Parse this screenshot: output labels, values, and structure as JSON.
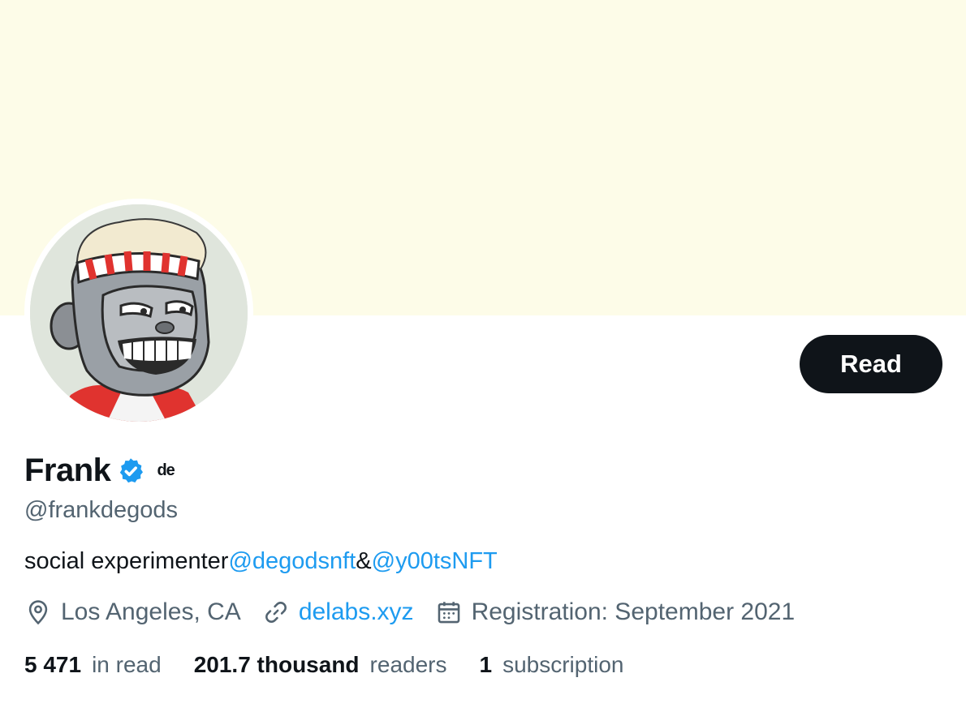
{
  "banner": {
    "color": "#fdfce8"
  },
  "profile": {
    "display_name": "Frank",
    "affiliate_label": "de",
    "handle": "@frankdegods",
    "bio": {
      "text_1": "social experimenter",
      "mention_1": "@degodsnft",
      "text_2": "&",
      "mention_2": "@y00tsNFT"
    },
    "location": "Los Angeles, CA",
    "website": "delabs.xyz",
    "joined": "Registration: September 2021",
    "verified_icon": "verified-badge-icon"
  },
  "actions": {
    "read_label": "Read"
  },
  "stats": {
    "following_count": "5 471",
    "following_label": "in read",
    "followers_count": "201.7 thousand",
    "followers_label": "readers",
    "subscriptions_count": "1",
    "subscriptions_label": "subscription"
  },
  "colors": {
    "accent": "#1d9bf0",
    "text_primary": "#0f1419",
    "text_secondary": "#536471",
    "button_bg": "#0f1419"
  }
}
